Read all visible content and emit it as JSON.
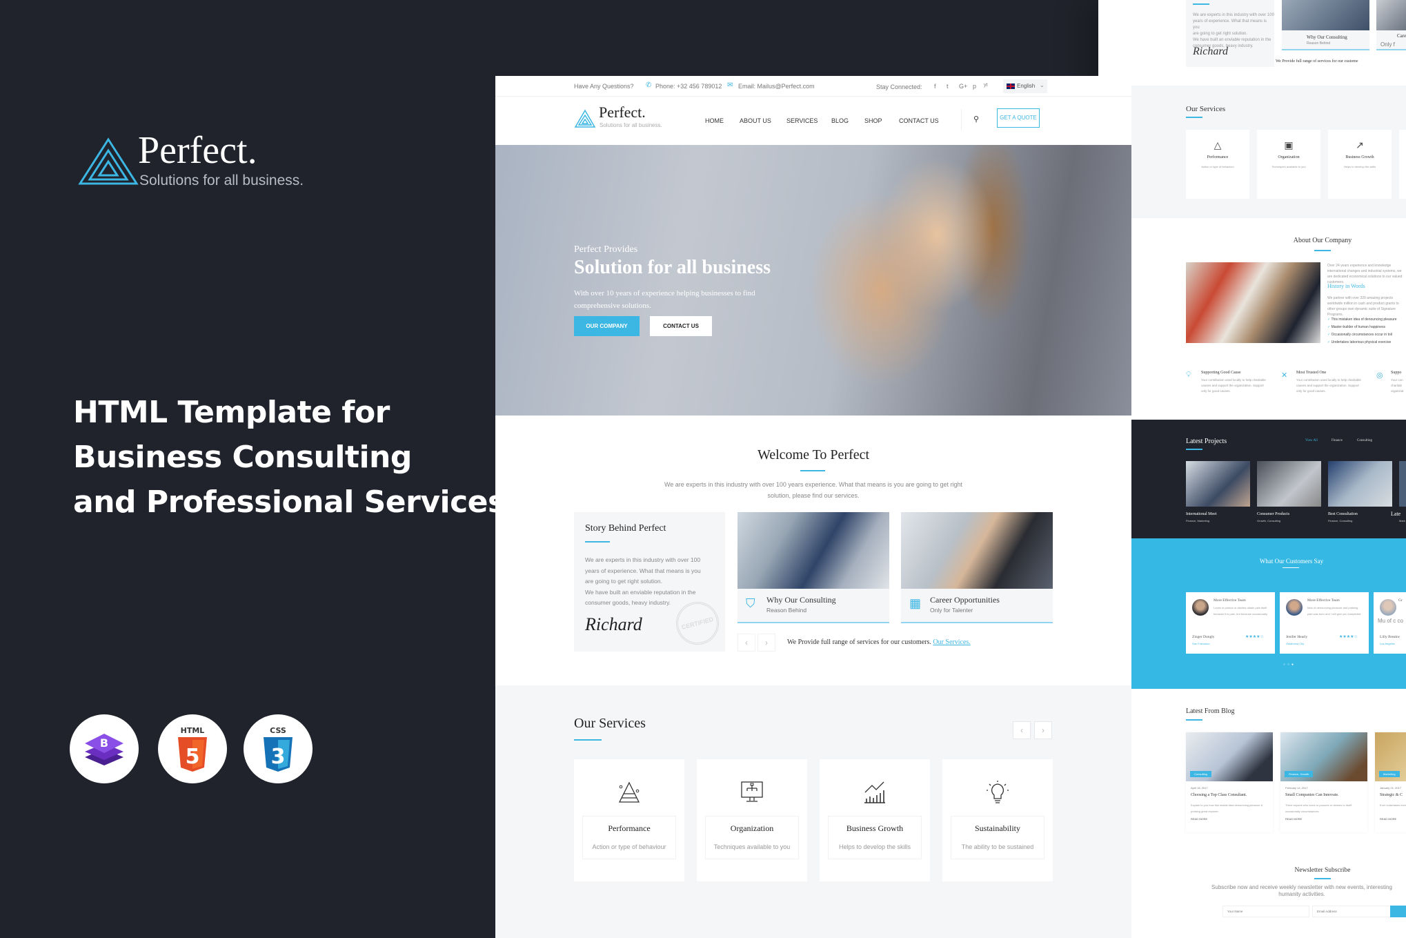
{
  "promo": {
    "brand": "Perfect.",
    "tagline": "Solutions for all business.",
    "headline": [
      "HTML Template for",
      "Business Consulting",
      "and Professional Services"
    ],
    "badges": [
      {
        "icon": "bootstrap-icon",
        "label": "B"
      },
      {
        "icon": "html5-icon",
        "label": "HTML"
      },
      {
        "icon": "css3-icon",
        "label": "CSS"
      }
    ]
  },
  "colors": {
    "accent": "#3cb6e3",
    "dark": "#20232b",
    "light_bg": "#f5f6f8"
  },
  "topbar": {
    "question": "Have Any Questions?",
    "phone": "Phone: +32 456 789012",
    "email": "Email: Mailus@Perfect.com",
    "stay": "Stay Connected:",
    "social": [
      "f",
      "t",
      "G+",
      "p",
      "yt"
    ],
    "language": "English"
  },
  "nav": {
    "brand": "Perfect.",
    "tagline": "Solutions for all business.",
    "items": [
      "HOME",
      "ABOUT US",
      "SERVICES",
      "BLOG",
      "SHOP",
      "CONTACT US"
    ],
    "quote": "GET A QUOTE"
  },
  "hero": {
    "kicker": "Perfect Provides",
    "title": "Solution for all business",
    "text1": "With over 10 years of experience helping businesses to find",
    "text2": "comprehensive solutions.",
    "btn1": "OUR COMPANY",
    "btn2": "CONTACT US"
  },
  "welcome": {
    "title": "Welcome To Perfect",
    "text1": "We are experts in this industry with over 100 years experience. What that means is you are going to get right",
    "text2": "solution, please find our services.",
    "story": {
      "title": "Story Behind Perfect",
      "lines": [
        "We are experts in this industry with over 100",
        "years of experience. What that means is you",
        "are going to get right solution.",
        "We have built an enviable reputation in the",
        "consumer goods, heavy industry."
      ],
      "signature": "Richard",
      "stamp": "CERTIFIED"
    },
    "cards": [
      {
        "title": "Why Our Consulting",
        "sub": "Reason Behind",
        "icon": "shield-globe-icon"
      },
      {
        "title": "Career Opportunities",
        "sub": "Only for Talenter",
        "icon": "monitor-chart-icon"
      }
    ],
    "tagline": "We Provide full range of services for our customers.",
    "link": "Our Services."
  },
  "services": {
    "title": "Our Services",
    "items": [
      {
        "title": "Performance",
        "sub": "Action or type of behaviour",
        "icon": "pyramid-icon"
      },
      {
        "title": "Organization",
        "sub": "Techniques available to you",
        "icon": "org-chart-monitor-icon"
      },
      {
        "title": "Business Growth",
        "sub": "Helps to develop the skills",
        "icon": "growth-chart-icon"
      },
      {
        "title": "Sustainability",
        "sub": "The ability to be sustained",
        "icon": "lightbulb-icon"
      }
    ]
  },
  "preview": {
    "about": {
      "title": "About Our Company",
      "intro": "Over 24 years experience and knowledge international changes and industrial systems, we are dedicated economical solutions to our valued customers.",
      "history": "History in Words",
      "history_text": "We partner with over 320 amazing projects worldwide million in cash and product grants to other groups own dynamic suite of Signature Programs.",
      "checks": [
        "This mistaken idea of denouncing pleasure",
        "Master-builder of human happiness",
        "Occasionally circumstances occur in toil",
        "Undertakes laborious physical exercise"
      ],
      "features": [
        {
          "title": "Supporting Good Cause",
          "text": "Your contribution used locally to help charitable causes and support the organization. Support only for good causes."
        },
        {
          "title": "Most Trusted One",
          "text": "Your contribution used locally to help charitable causes and support the organization. Support only for good causes."
        },
        {
          "title": "Suppo",
          "text": "Your con charitab organizat"
        }
      ]
    },
    "projects": {
      "title": "Latest Projects",
      "filters": [
        "View All",
        "Finance",
        "Consulting"
      ],
      "items": [
        {
          "title": "International Meet",
          "tags": "Finance, Marketing"
        },
        {
          "title": "Consumer Products",
          "tags": "Growth, Consulting"
        },
        {
          "title": "Best Consultation",
          "tags": "Finance, Consulting"
        },
        {
          "title": "Late",
          "tags": "Mark"
        }
      ]
    },
    "testimonials": {
      "title": "What Our Customers Say",
      "items": [
        {
          "title": "More Effective Team",
          "text": "Loves or pursue or desires obtain pain itself because it is pain, but because occasionally.",
          "name": "Zinger Dongly",
          "city": "San Francisco"
        },
        {
          "title": "More Effective Team",
          "text": "Idea of denouncing pleasure and praising pain was born and I will give you completed.",
          "name": "Jenifer Hearly",
          "city": "Oklahoma City"
        },
        {
          "title": "Gr",
          "text": "Mu of c co",
          "name": "Lilly Breakw",
          "city": "Los Angeles"
        }
      ]
    },
    "blog": {
      "title": "Latest From Blog",
      "items": [
        {
          "tag": "Consulting",
          "date": "April 18, 2017",
          "title": "Choosing a Top Class Consultant.",
          "text": "Explain to you how this mistak idea denouncing pleasure & praising great explorer.",
          "more": "READ MORE"
        },
        {
          "tag": "Finance, Growth",
          "date": "February 14, 2017",
          "title": "Small Companies Can Innovate.",
          "text": "There anyone who loves or pursues or desires to itself occasionally circumstances.",
          "more": "READ MORE"
        },
        {
          "tag": "Marketing",
          "date": "January 21, 2017",
          "title": "Strategic & C",
          "text": "Ever undertakes exercise, except",
          "more": "READ MORE"
        }
      ]
    },
    "newsletter": {
      "title": "Newsletter Subscribe",
      "text": "Subscribe now and receive weekly newsletter with new events, interesting humanity activities.",
      "name_placeholder": "Your Name",
      "email_placeholder": "Email Address"
    },
    "story_fragment": {
      "lines": [
        "We are experts in this industry with over 100",
        "years of experience. What that means is you",
        "are going to get right solution.",
        "We have built an enviable reputation in the",
        "consumer goods, heavy industry."
      ],
      "card": "Why Our Consulting",
      "card_sub": "Reason Behind",
      "card2": "Care",
      "card2_sub": "Only f",
      "tagline": "We Provide full range of services for our custome"
    },
    "services": {
      "title": "Our Services",
      "items": [
        {
          "title": "Performance",
          "sub": "Action or type of behaviour"
        },
        {
          "title": "Organization",
          "sub": "Techniques available to you"
        },
        {
          "title": "Business Growth",
          "sub": "Helps to develop the skills"
        }
      ]
    }
  }
}
